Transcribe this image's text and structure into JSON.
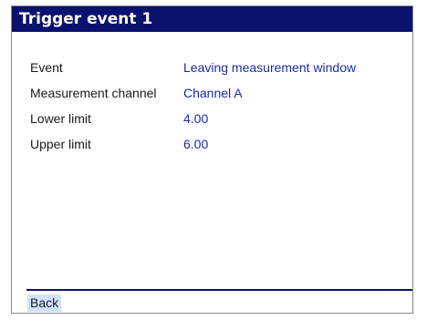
{
  "window": {
    "title": "Trigger event 1"
  },
  "fields": [
    {
      "label": "Event",
      "value": "Leaving measurement window"
    },
    {
      "label": "Measurement channel",
      "value": "Channel A"
    },
    {
      "label": "Lower limit",
      "value": "4.00"
    },
    {
      "label": "Upper limit",
      "value": "6.00"
    }
  ],
  "footer": {
    "back_label": "Back"
  },
  "colors": {
    "title_bar": "#0a126e",
    "value_text": "#1b2aa8",
    "back_highlight": "#cfe2ff"
  }
}
